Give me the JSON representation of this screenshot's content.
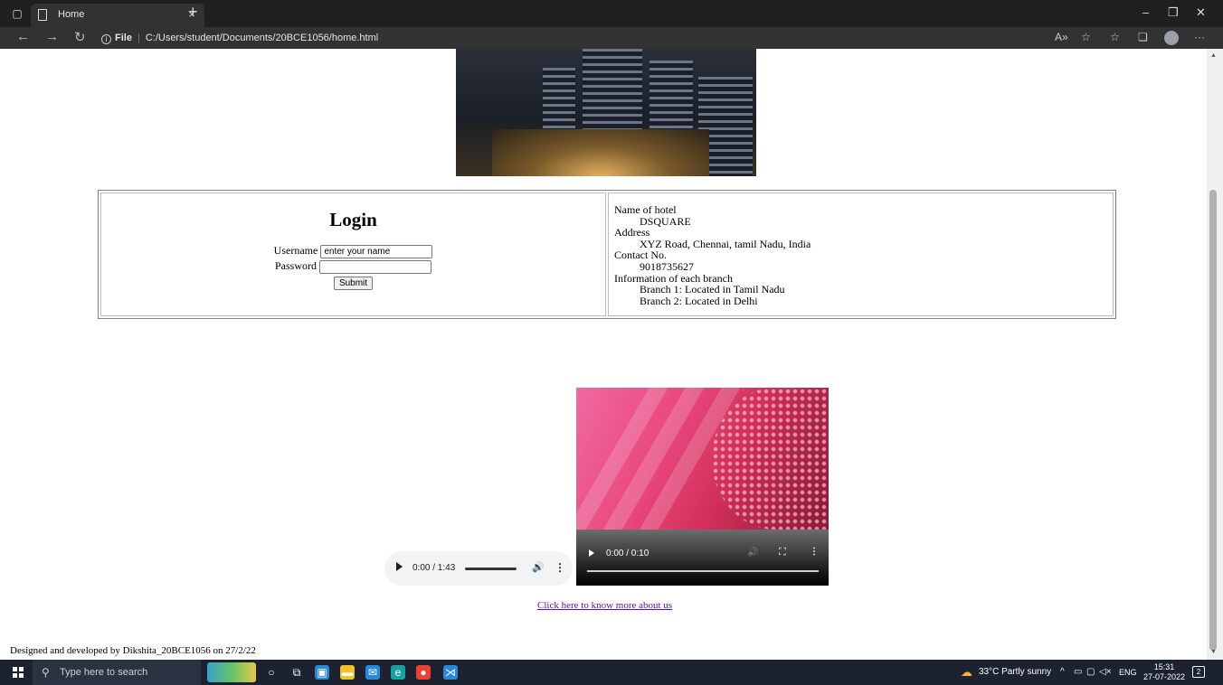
{
  "browser": {
    "tab_title": "Home",
    "tab_close": "×",
    "new_tab": "+",
    "file_label": "File",
    "separator": "|",
    "url": "C:/Users/student/Documents/20BCE1056/home.html",
    "info_glyph": "i",
    "back": "←",
    "forward": "→",
    "refresh": "↻",
    "minimize": "–",
    "restore": "❐",
    "close": "✕",
    "read_aloud": "A»",
    "favorites_add": "☆",
    "favorites": "☆",
    "collections": "❏",
    "more": "···"
  },
  "login": {
    "title": "Login",
    "username_label": "Username",
    "username_value": "enter your name",
    "password_label": "Password",
    "password_value": "",
    "submit_label": "Submit"
  },
  "hotel_info": {
    "items": [
      {
        "term": "Name of hotel",
        "details": [
          "DSQUARE"
        ]
      },
      {
        "term": "Address",
        "details": [
          "XYZ Road, Chennai, tamil Nadu, India"
        ]
      },
      {
        "term": "Contact No.",
        "details": [
          "9018735627"
        ]
      },
      {
        "term": "Information of each branch",
        "details": [
          "Branch 1: Located in Tamil Nadu",
          "Branch 2: Located in Delhi"
        ]
      }
    ]
  },
  "audio": {
    "time": "0:00 / 1:43",
    "volume_glyph": "🔊",
    "more_glyph": "⋮",
    "progress": 0
  },
  "video": {
    "time": "0:00 / 0:10",
    "volume_glyph": "🔊",
    "fullscreen_glyph": "⛶",
    "more_glyph": "⋮",
    "progress": 0
  },
  "more_link": "Click here to know more about us",
  "footer": "Designed and developed by Dikshita_20BCE1056 on 27/2/22",
  "taskbar": {
    "search_placeholder": "Type here to search",
    "search_glyph": "⚲",
    "weather": "33°C  Partly sunny",
    "tray_arrow": "^",
    "language": "ENG",
    "time": "15:31",
    "date": "27-07-2022",
    "notifications_count": "2",
    "pinned_apps": [
      {
        "name": "cortana",
        "glyph": "○",
        "color": "#1c2230"
      },
      {
        "name": "task-view",
        "glyph": "⧉",
        "color": "#1c2230"
      },
      {
        "name": "store",
        "glyph": "▣",
        "color": "#2b88d8"
      },
      {
        "name": "file-explorer",
        "glyph": "▬",
        "color": "#f2c12e"
      },
      {
        "name": "mail",
        "glyph": "✉",
        "color": "#2b88d8"
      },
      {
        "name": "edge",
        "glyph": "e",
        "color": "#1aa0a0"
      },
      {
        "name": "chrome",
        "glyph": "●",
        "color": "#e94235"
      },
      {
        "name": "vscode",
        "glyph": "⋊",
        "color": "#2b88d8"
      }
    ]
  }
}
